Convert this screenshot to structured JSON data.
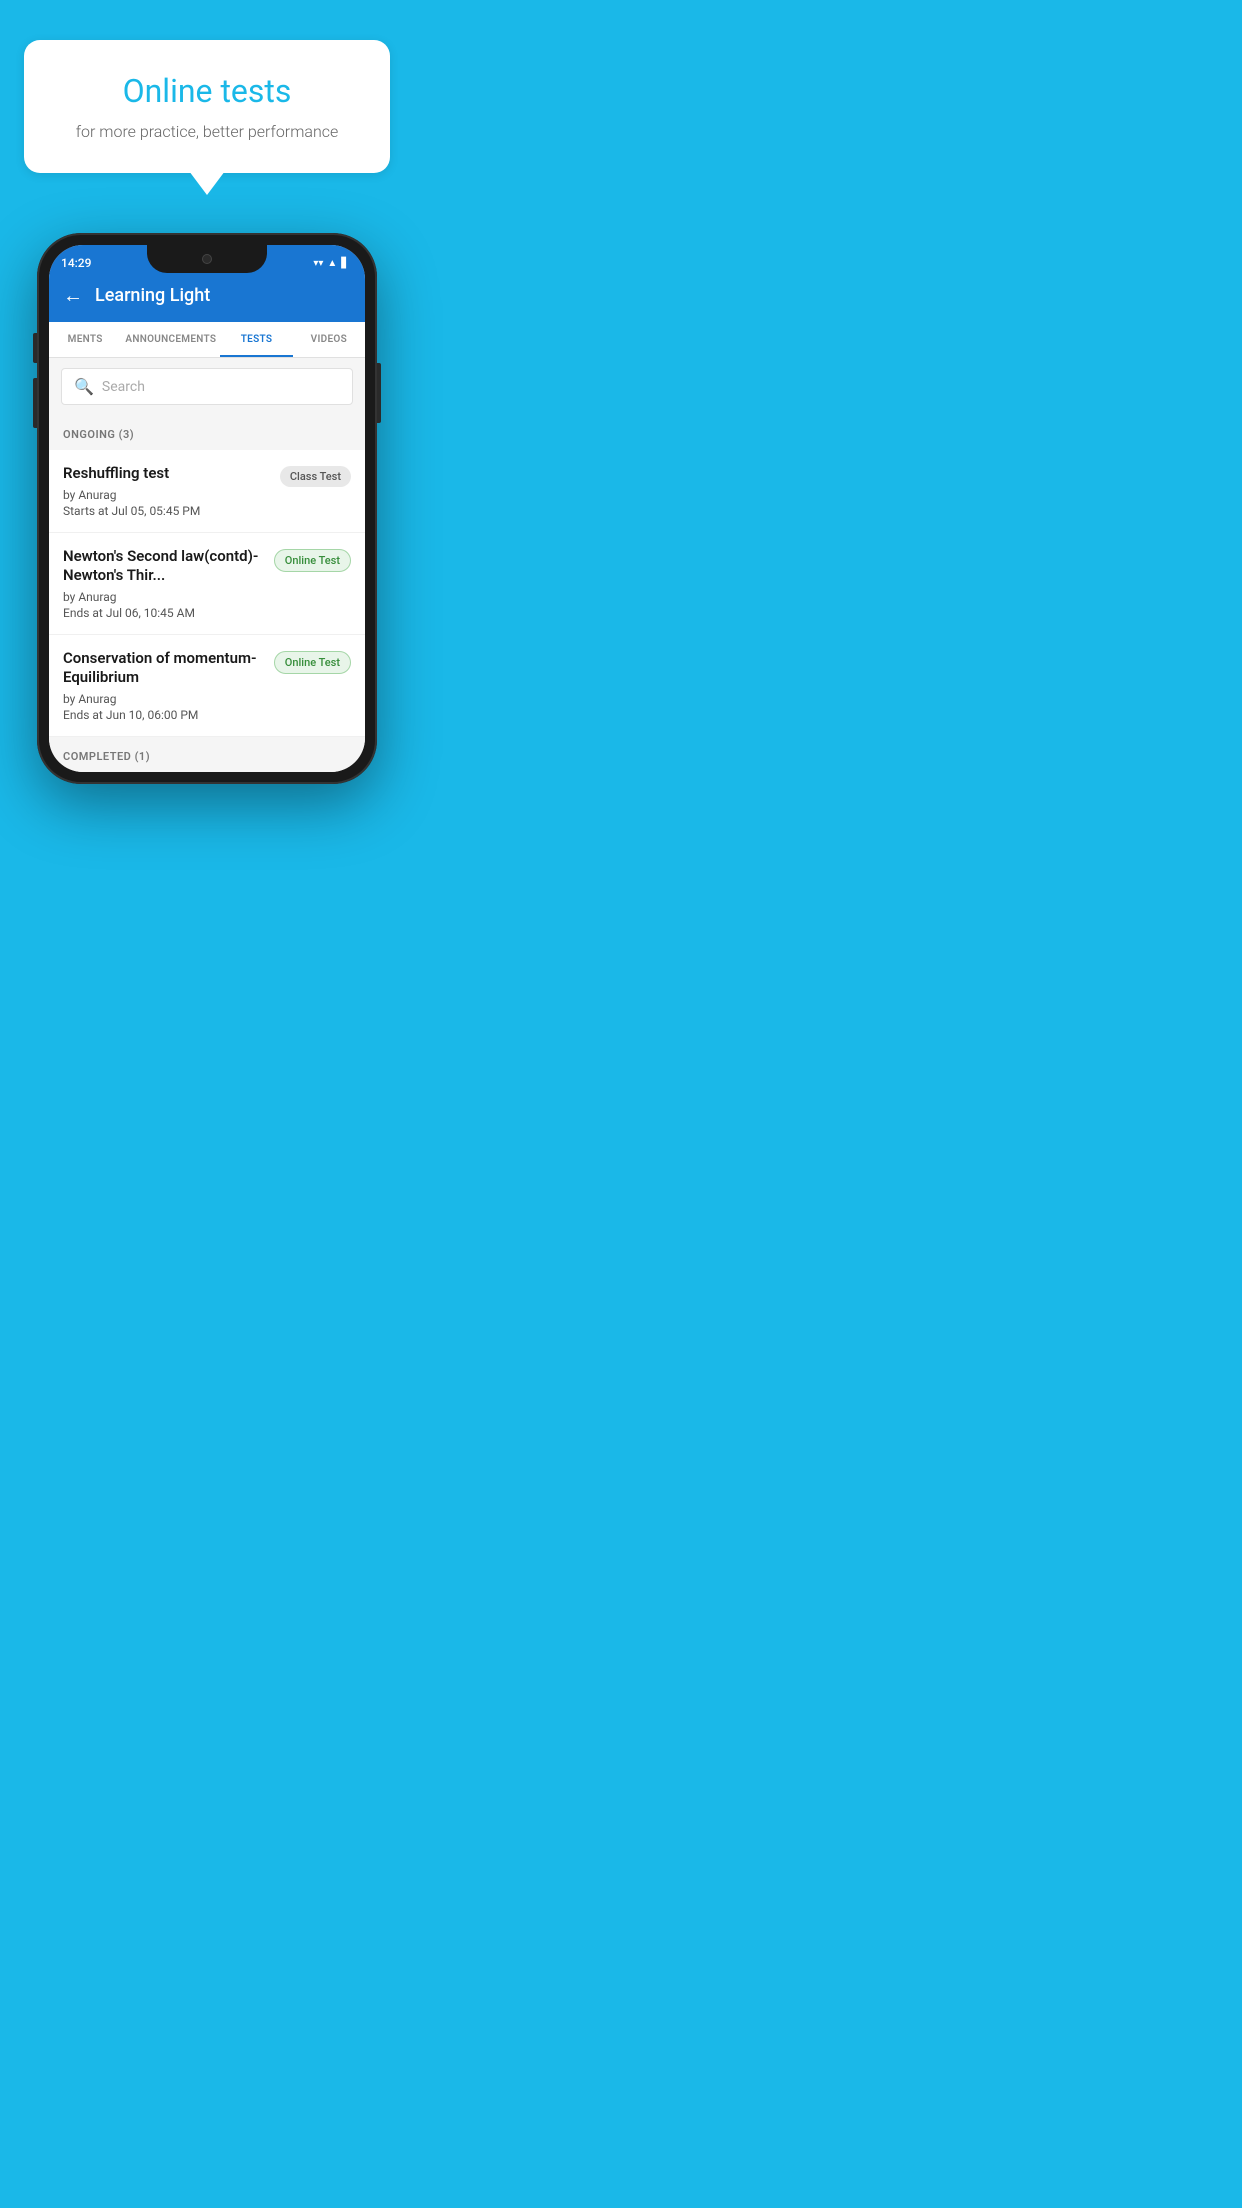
{
  "background_color": "#1ab8e8",
  "promo": {
    "title": "Online tests",
    "subtitle": "for more practice, better performance"
  },
  "phone": {
    "status_bar": {
      "time": "14:29",
      "wifi_icon": "▼",
      "signal_icon": "▲",
      "battery_icon": "▋"
    },
    "header": {
      "back_label": "←",
      "title": "Learning Light"
    },
    "tabs": [
      {
        "label": "MENTS",
        "active": false
      },
      {
        "label": "ANNOUNCEMENTS",
        "active": false
      },
      {
        "label": "TESTS",
        "active": true
      },
      {
        "label": "VIDEOS",
        "active": false
      }
    ],
    "search": {
      "placeholder": "Search"
    },
    "ongoing_section": {
      "label": "ONGOING (3)"
    },
    "tests": [
      {
        "name": "Reshuffling test",
        "by": "by Anurag",
        "time_label": "Starts at",
        "time": "Jul 05, 05:45 PM",
        "badge": "Class Test",
        "badge_type": "class"
      },
      {
        "name": "Newton's Second law(contd)-Newton's Thir...",
        "by": "by Anurag",
        "time_label": "Ends at",
        "time": "Jul 06, 10:45 AM",
        "badge": "Online Test",
        "badge_type": "online"
      },
      {
        "name": "Conservation of momentum-Equilibrium",
        "by": "by Anurag",
        "time_label": "Ends at",
        "time": "Jun 10, 06:00 PM",
        "badge": "Online Test",
        "badge_type": "online"
      }
    ],
    "completed_section": {
      "label": "COMPLETED (1)"
    }
  }
}
